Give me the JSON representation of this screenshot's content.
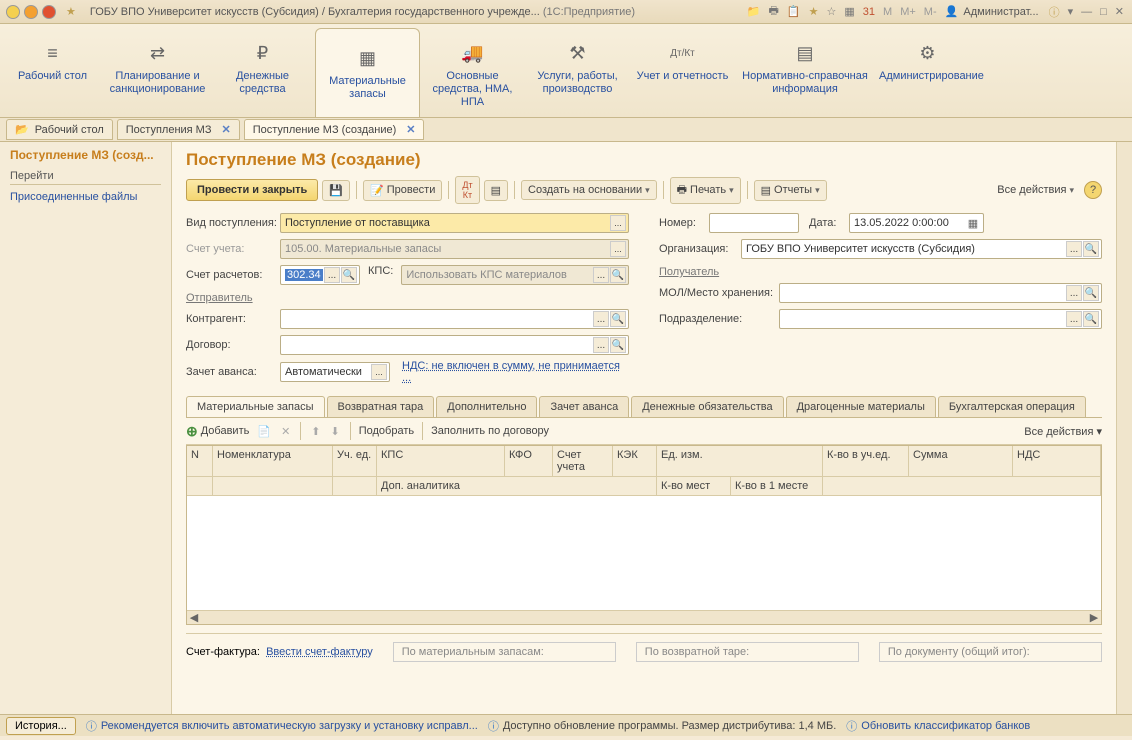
{
  "titlebar": {
    "text": "ГОБУ ВПО Университет искусств (Субсидия) / Бухгалтерия государственного учрежде...",
    "app": "(1С:Предприятие)",
    "user": "Администрат..."
  },
  "mainnav": [
    {
      "icon": "≡",
      "label": "Рабочий стол"
    },
    {
      "icon": "⇄",
      "label": "Планирование и санкционирование"
    },
    {
      "icon": "₽",
      "label": "Денежные средства"
    },
    {
      "icon": "▦",
      "label": "Материальные запасы"
    },
    {
      "icon": "🚚",
      "label": "Основные средства, НМА, НПА"
    },
    {
      "icon": "⚒",
      "label": "Услуги, работы, производство"
    },
    {
      "icon": "Дт/Кт",
      "label": "Учет и отчетность"
    },
    {
      "icon": "▤",
      "label": "Нормативно-справочная информация"
    },
    {
      "icon": "⚙",
      "label": "Администрирование"
    }
  ],
  "tabs": [
    {
      "label": "Рабочий стол"
    },
    {
      "label": "Поступления МЗ"
    },
    {
      "label": "Поступление МЗ (создание)",
      "active": true
    }
  ],
  "sidebar": {
    "title": "Поступление МЗ (созд...",
    "section": "Перейти",
    "link": "Присоединенные файлы"
  },
  "form": {
    "title": "Поступление МЗ (создание)",
    "toolbar": {
      "primary": "Провести и закрыть",
      "save": "💾",
      "post": "Провести",
      "create_based": "Создать на основании",
      "print": "Печать",
      "reports": "Отчеты",
      "all_actions": "Все действия"
    },
    "fields": {
      "vid_label": "Вид поступления:",
      "vid_value": "Поступление от поставщика",
      "schet_ucheta_label": "Счет учета:",
      "schet_ucheta_value": "105.00. Материальные запасы",
      "schet_raschetov_label": "Счет расчетов:",
      "schet_raschetov_value": "302.34",
      "kps_label": "КПС:",
      "kps_placeholder": "Использовать КПС материалов",
      "otpravitel": "Отправитель",
      "kontragent_label": "Контрагент:",
      "dogovor_label": "Договор:",
      "zachet_label": "Зачет аванса:",
      "zachet_value": "Автоматически",
      "nds_link": "НДС: не включен в сумму, не принимается ...",
      "nomer_label": "Номер:",
      "data_label": "Дата:",
      "data_value": "13.05.2022  0:00:00",
      "org_label": "Организация:",
      "org_value": "ГОБУ ВПО Университет искусств (Субсидия)",
      "poluchatel": "Получатель",
      "mol_label": "МОЛ/Место хранения:",
      "podrazd_label": "Подразделение:"
    },
    "subtabs": [
      "Материальные запасы",
      "Возвратная тара",
      "Дополнительно",
      "Зачет аванса",
      "Денежные обязательства",
      "Драгоценные материалы",
      "Бухгалтерская операция"
    ],
    "subtoolbar": {
      "add": "Добавить",
      "pick": "Подобрать",
      "fill": "Заполнить по договору",
      "all": "Все действия"
    },
    "grid_headers": {
      "n": "N",
      "nom": "Номенклатура",
      "uched": "Уч. ед.",
      "kps": "КПС",
      "kfo": "КФО",
      "schet": "Счет учета",
      "kek": "КЭК",
      "edizm": "Ед. изм.",
      "kvo_uched": "К-во в уч.ед.",
      "summa": "Сумма",
      "nds": "НДС",
      "dop": "Доп. аналитика",
      "kvomest": "К-во мест",
      "kvo1": "К-во в 1 месте"
    },
    "footer": {
      "sf_label": "Счет-фактура:",
      "sf_link": "Ввести счет-фактуру",
      "sum1": "По материальным запасам:",
      "sum2": "По возвратной таре:",
      "sum3": "По документу (общий итог):"
    }
  },
  "statusbar": {
    "history": "История...",
    "msg1": "Рекомендуется включить автоматическую загрузку и установку исправл...",
    "msg2": "Доступно обновление программы. Размер дистрибутива: 1,4 МБ.",
    "msg3": "Обновить классификатор банков"
  }
}
